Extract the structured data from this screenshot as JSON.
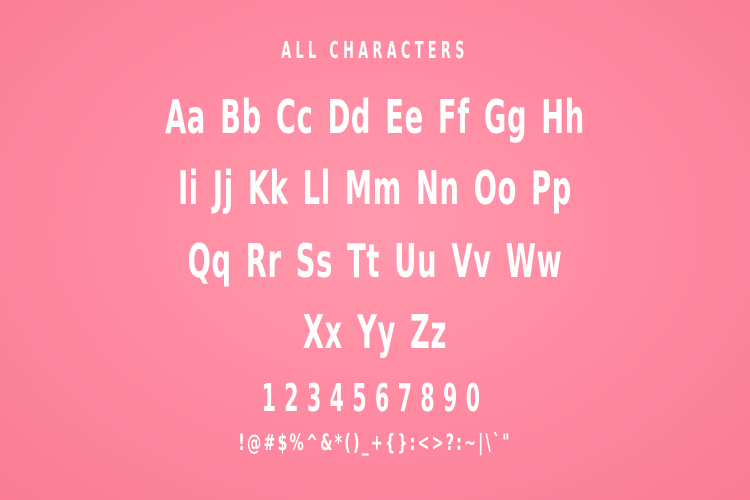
{
  "specimen": {
    "heading": "ALL CHARACTERS",
    "rows": [
      "Aa Bb Cc Dd Ee Ff Gg Hh",
      "Ii Jj Kk Ll Mm Nn Oo Pp",
      "Qq Rr Ss Tt Uu Vv Ww",
      "Xx Yy Zz"
    ],
    "digits": "1234567890",
    "symbols": "!@#$%^&*()_+{}:<>?:~|\\`\""
  },
  "colors": {
    "background": "#ff8ba2",
    "text": "#ffffff"
  }
}
